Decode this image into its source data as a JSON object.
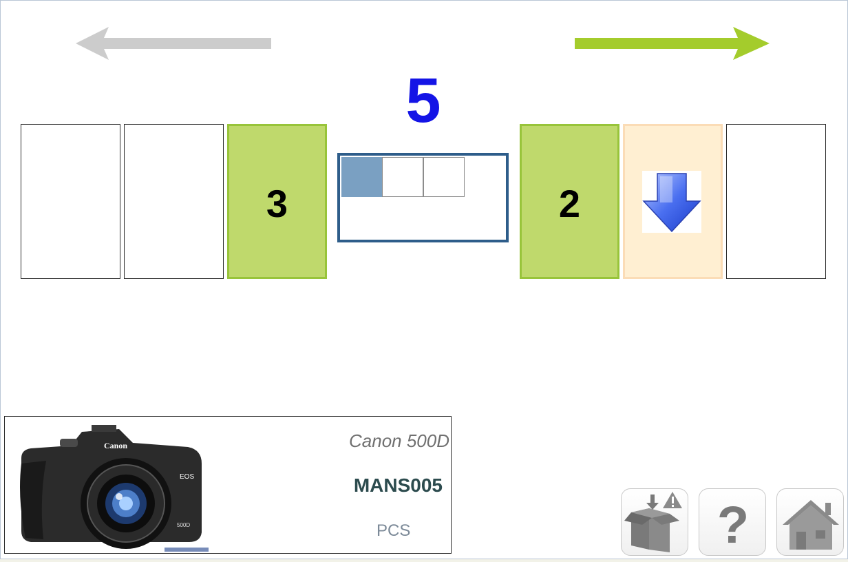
{
  "counter": "5",
  "slots": {
    "left_green": "3",
    "right_green": "2"
  },
  "grid": {
    "filled_cells": 1,
    "total_cells": 3
  },
  "product": {
    "name": "Canon 500D",
    "code": "MANS005",
    "unit": "PCS",
    "image_icon": "camera-image"
  },
  "toolbar": {
    "buttons": [
      "report-issue-icon",
      "help-icon",
      "home-icon"
    ]
  },
  "colors": {
    "accent_green": "#98c43a",
    "counter_blue": "#1414e6",
    "grid_border": "#2e5d8a",
    "back_arrow_gray": "#cccccc"
  }
}
